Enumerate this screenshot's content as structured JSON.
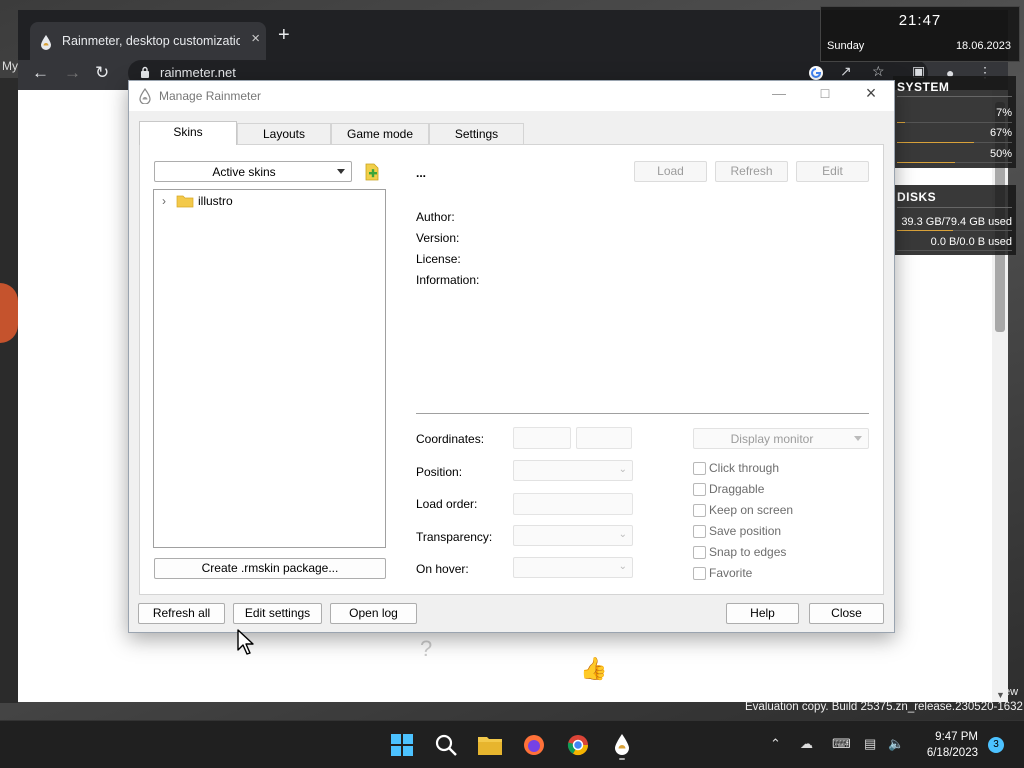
{
  "browser": {
    "tab_title": "Rainmeter, desktop customization",
    "tab_close": "×",
    "new_tab": "+",
    "url": "rainmeter.net"
  },
  "desktop": {
    "left_label": "My"
  },
  "clock_widget": {
    "time": "21:47",
    "day": "Sunday",
    "date": "18.06.2023"
  },
  "system_widget": {
    "title": "SYSTEM",
    "rows": [
      {
        "value": "7%",
        "fill": 0.07
      },
      {
        "value": "67%",
        "fill": 0.67
      },
      {
        "value": "50%",
        "fill": 0.5
      }
    ]
  },
  "disks_widget": {
    "title": "DISKS",
    "rows": [
      {
        "value": "39.3 GB/79.4 GB used",
        "fill": 0.49
      },
      {
        "value": "0.0 B/0.0 B used",
        "fill": 0.0
      }
    ]
  },
  "dialog": {
    "title": "Manage Rainmeter",
    "tabs": [
      "Skins",
      "Layouts",
      "Game mode",
      "Settings"
    ],
    "skins": {
      "dropdown": "Active skins",
      "tree_items": [
        "illustro"
      ],
      "selected_name": "...",
      "buttons": {
        "load": "Load",
        "refresh": "Refresh",
        "edit": "Edit"
      },
      "info_labels": [
        "Author:",
        "Version:",
        "License:",
        "Information:"
      ],
      "create_package": "Create .rmskin package...",
      "settings_labels": {
        "coordinates": "Coordinates:",
        "position": "Position:",
        "load_order": "Load order:",
        "transparency": "Transparency:",
        "on_hover": "On hover:"
      },
      "display_monitor": "Display monitor",
      "checkboxes": [
        "Click through",
        "Draggable",
        "Keep on screen",
        "Save position",
        "Snap to edges",
        "Favorite"
      ]
    },
    "footer": {
      "refresh_all": "Refresh all",
      "edit_settings": "Edit settings",
      "open_log": "Open log",
      "help": "Help",
      "close": "Close"
    }
  },
  "watermark": {
    "text": "Evaluation copy. Build 25375.zn_release.230520-1632",
    "cutoff": "ew"
  },
  "taskbar": {
    "time": "9:47 PM",
    "date": "6/18/2023",
    "notifications": "3"
  },
  "colors": {
    "accent_green": "#1e9c5a",
    "widget_bar": "#d9a23a",
    "notif_badge": "#4cc2ff"
  }
}
